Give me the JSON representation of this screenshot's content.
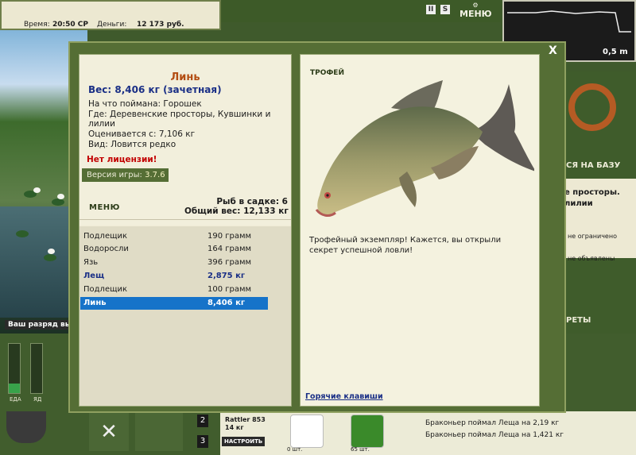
{
  "hud": {
    "time_label": "Время:",
    "time_value": "20:50 СР",
    "money_label": "Деньги:",
    "money_value": "12 173 руб.",
    "menu_label": "МЕНЮ",
    "depth_value": "0,5 m"
  },
  "background": {
    "rank_text": "Ваш разряд вы",
    "base_text": "ся на базу",
    "place_text_1": "е просторы.",
    "place_text_2": "лилии",
    "limit_text_1": "не ограничено",
    "limit_text_2": "не объявлены",
    "secrets_label": "РЕТЫ",
    "food_label": "ЕДА",
    "fatigue_label": "ЯД",
    "slot_2": "2",
    "slot_3": "3",
    "lure_name": "Rattler 853",
    "lure_weight": "14 кг",
    "setup_button": "НАСТРОИТЬ",
    "count_1": "0 шт.",
    "count_2": "65 шт.",
    "news": [
      "Браконьер поймал Леща на 2,19 кг",
      "Браконьер поймал Леща на 1,421 кг"
    ]
  },
  "catch": {
    "fish_name": "Линь",
    "weight_line": "Вес: 8,406 кг (зачетная)",
    "bait_line": "На что поймана: Горошек",
    "where_line_1": "Где: Деревенские просторы, Кувшинки и",
    "where_line_2": "лилии",
    "price_line": "Оценивается с: 7,106 кг",
    "kind_line": "Вид: Ловится редко",
    "license_warning": "Нет лицензии!",
    "version_label": "Версия игры:",
    "version_value": "3.7.6",
    "menu_button": "МЕНЮ",
    "sadok_count": "Рыб в садке: 6",
    "sadok_weight": "Общий вес: 12,133 кг"
  },
  "catch_list": [
    {
      "name": "Подлещик",
      "weight": "190 грамм",
      "style": "normal"
    },
    {
      "name": "Водоросли",
      "weight": "164 грамм",
      "style": "normal"
    },
    {
      "name": "Язь",
      "weight": "396 грамм",
      "style": "normal"
    },
    {
      "name": "Лещ",
      "weight": "2,875 кг",
      "style": "bold"
    },
    {
      "name": "Подлещик",
      "weight": "100 грамм",
      "style": "normal"
    },
    {
      "name": "Линь",
      "weight": "8,406 кг",
      "style": "selected"
    }
  ],
  "trophy": {
    "title": "ТРОФЕЙ",
    "description": "Трофейный экземпляр! Кажется, вы открыли секрет успешной ловли!",
    "hotkeys_link": "Горячие клавиши",
    "close_label": "X"
  },
  "colors": {
    "accent_green": "#556e35",
    "selected_row": "#1673c9",
    "fish_name": "#b34d12",
    "weight_blue": "#1a2f86",
    "warning_red": "#c20000"
  }
}
